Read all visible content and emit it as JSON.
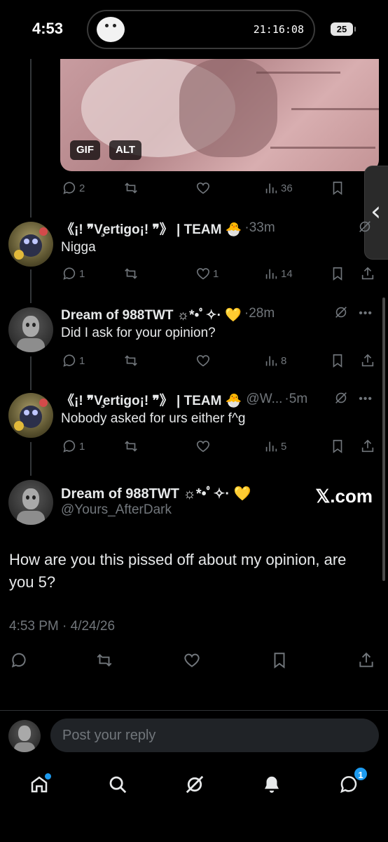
{
  "status": {
    "time": "4:53",
    "island_time": "21:16:08",
    "battery": "25"
  },
  "gif": {
    "badge_gif": "GIF",
    "badge_alt": "ALT",
    "replies": "2",
    "views": "36"
  },
  "tweets": [
    {
      "name": "《¡! ❞V̧ertigo¡! ❞》 | TEAM 🐣",
      "handle": "",
      "time": "·33m",
      "text": "Nigga",
      "replies": "1",
      "reposts": "",
      "likes": "1",
      "views": "14"
    },
    {
      "name": "Dream of 988TWT ☼*•ﾟ✧· 💛",
      "handle": "",
      "time": "·28m",
      "text": "Did I ask for your opinion?",
      "replies": "1",
      "reposts": "",
      "likes": "",
      "views": "8"
    },
    {
      "name": "《¡! ❞V̧ertigo¡! ❞》 | TEAM 🐣",
      "handle": "@W...",
      "time": "·5m",
      "text": "Nobody asked for urs either f^g",
      "replies": "1",
      "reposts": "",
      "likes": "",
      "views": "5"
    }
  ],
  "main": {
    "name": "Dream of 988TWT ☼*•ﾟ✧· 💛",
    "handle": "@Yours_AfterDark",
    "watermark": "𝕏.com",
    "text": "How are you this pissed off about my opinion, are you 5?",
    "timestamp": "4:53 PM · 4/24/26"
  },
  "reply": {
    "placeholder": "Post your reply"
  },
  "tabs": {
    "messages_badge": "1"
  },
  "colors": {
    "background": "#000000",
    "text": "#e7e9ea",
    "muted": "#71767b",
    "accent": "#1d9bf0"
  }
}
